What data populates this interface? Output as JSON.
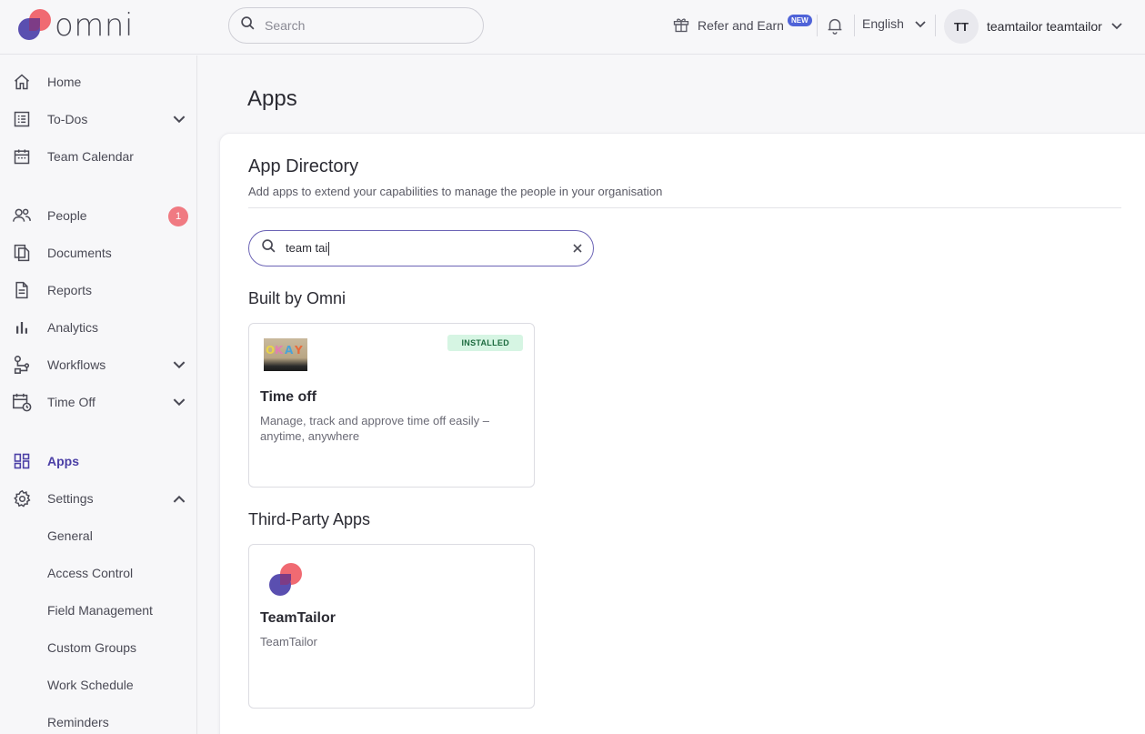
{
  "brand": {
    "name": "omni"
  },
  "topbar": {
    "search_placeholder": "Search",
    "refer_label": "Refer and Earn",
    "new_badge": "NEW",
    "language": "English",
    "user_initials": "TT",
    "user_name": "teamtailor teamtailor"
  },
  "sidebar": {
    "items": [
      {
        "label": "Home",
        "icon": "home-icon"
      },
      {
        "label": "To-Dos",
        "icon": "list-icon"
      },
      {
        "label": "Team Calendar",
        "icon": "calendar-icon"
      },
      {
        "label": "People",
        "icon": "people-icon",
        "badge": "1"
      },
      {
        "label": "Documents",
        "icon": "documents-icon"
      },
      {
        "label": "Reports",
        "icon": "report-icon"
      },
      {
        "label": "Analytics",
        "icon": "analytics-icon"
      },
      {
        "label": "Workflows",
        "icon": "workflow-icon"
      },
      {
        "label": "Time Off",
        "icon": "time-off-icon"
      },
      {
        "label": "Apps",
        "icon": "apps-icon",
        "active": true
      },
      {
        "label": "Settings",
        "icon": "gear-icon"
      }
    ],
    "settings_sub": [
      "General",
      "Access Control",
      "Field Management",
      "Custom Groups",
      "Work Schedule",
      "Reminders"
    ]
  },
  "main": {
    "page_title": "Apps",
    "directory_title": "App Directory",
    "directory_desc": "Add apps to extend your capabilities to manage the people in your organisation",
    "search_value": "team tai",
    "sections": [
      {
        "title": "Built by Omni",
        "cards": [
          {
            "name": "Time off",
            "desc": "Manage, track and approve time off easily – anytime, anywhere",
            "status": "INSTALLED",
            "thumb_text": "OKAY"
          }
        ]
      },
      {
        "title": "Third-Party Apps",
        "cards": [
          {
            "name": "TeamTailor",
            "desc": "TeamTailor"
          }
        ]
      }
    ]
  },
  "colors": {
    "accent": "#4b3fa6",
    "badge": "#f07a82",
    "installed_bg": "#d6f5e3",
    "logo_purple": "#5a4fb0",
    "logo_red": "#ef5d66"
  }
}
